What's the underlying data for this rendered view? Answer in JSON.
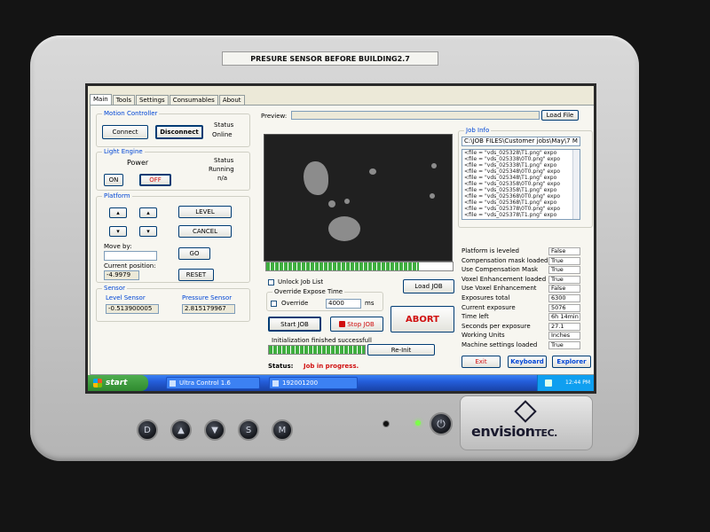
{
  "sticker": "PRESURE SENSOR BEFORE BUILDING2.7",
  "tabs": [
    "Main",
    "Tools",
    "Settings",
    "Consumables",
    "About"
  ],
  "motion_controller": {
    "title": "Motion Controller",
    "connect": "Connect",
    "disconnect": "Disconnect",
    "status_label": "Status",
    "status_value": "Online"
  },
  "light_engine": {
    "title": "Light Engine",
    "power_label": "Power",
    "status_label": "Status",
    "status_value1": "Running",
    "status_value2": "n/a",
    "on": "ON",
    "off": "OFF"
  },
  "platform": {
    "title": "Platform",
    "level": "LEVEL",
    "cancel": "CANCEL",
    "move_by": "Move by:",
    "go": "GO",
    "current_position_label": "Current position:",
    "current_position_value": "-4.9979",
    "reset": "RESET"
  },
  "sensor": {
    "title": "Sensor",
    "level_label": "Level Sensor",
    "level_value": "-0.513900005",
    "pressure_label": "Pressure Sensor",
    "pressure_value": "2.815179967"
  },
  "preview": {
    "label": "Preview:",
    "load_file": "Load File",
    "progress": 0.82
  },
  "controls": {
    "unlock_job_list": "Unlock Job List",
    "override_group": "Override Expose Time",
    "override_label": "Override",
    "override_value": "4000",
    "override_unit": "ms",
    "load_job": "Load JOB",
    "start_job": "Start JOB",
    "stop_job": "Stop JOB",
    "abort": "ABORT",
    "init_status": "Initialization finished successfull",
    "init_progress": 1.0,
    "reinit": "Re-Init",
    "status_label": "Status:",
    "status_value": "Job in progress."
  },
  "job_info": {
    "title": "Job Info",
    "path": "C:\\JOB FILES\\Customer jobs\\May\\7 M",
    "files": [
      "<file = \"vds_025328\\T1.png\" expo",
      "<file = \"vds_025338\\0T0.png\" expo",
      "<file = \"vds_025338\\T1.png\" expo",
      "<file = \"vds_025348\\0T0.png\" expo",
      "<file = \"vds_025348\\T1.png\" expo",
      "<file = \"vds_025358\\0T0.png\" expo",
      "<file = \"vds_025358\\T1.png\" expo",
      "<file = \"vds_025368\\0T0.png\" expo",
      "<file = \"vds_025368\\T1.png\" expo",
      "<file = \"vds_025378\\0T0.png\" expo",
      "<file = \"vds_025378\\T1.png\" expo"
    ],
    "rows": [
      {
        "k": "Platform is leveled",
        "v": "False"
      },
      {
        "k": "Compensation mask loaded",
        "v": "True"
      },
      {
        "k": "Use Compensation Mask",
        "v": "True"
      },
      {
        "k": "Voxel Enhancement loaded",
        "v": "True"
      },
      {
        "k": "Use Voxel Enhancement",
        "v": "False"
      },
      {
        "k": "Exposures total",
        "v": "6300"
      },
      {
        "k": "Current exposure",
        "v": "5076"
      },
      {
        "k": "Time left",
        "v": "6h 14min"
      },
      {
        "k": "Seconds per exposure",
        "v": "27.1"
      },
      {
        "k": "Working Units",
        "v": "Inches"
      },
      {
        "k": "Machine settings loaded",
        "v": "True"
      }
    ],
    "exit": "Exit",
    "keyboard": "Keyboard",
    "explorer": "Explorer"
  },
  "taskbar": {
    "start": "start",
    "item1": "Ultra Control 1.6",
    "item2": "192001200",
    "clock": "12:44 PM"
  },
  "hw_buttons": [
    "D",
    "▲",
    "▼",
    "S",
    "M"
  ],
  "brand": {
    "main": "envision",
    "suffix": "TEC."
  }
}
